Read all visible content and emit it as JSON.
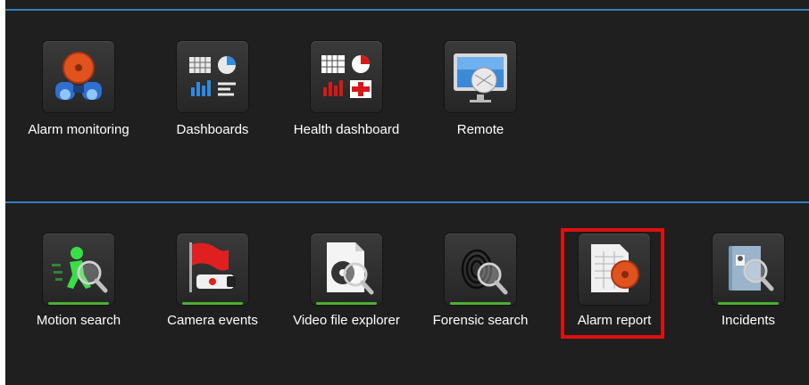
{
  "top_tasks": [
    {
      "label": "Alarm monitoring",
      "icon": "alarm-monitoring-icon"
    },
    {
      "label": "Dashboards",
      "icon": "dashboards-icon"
    },
    {
      "label": "Health dashboard",
      "icon": "health-dashboard-icon"
    },
    {
      "label": "Remote",
      "icon": "remote-icon"
    }
  ],
  "bottom_tasks": [
    {
      "label": "Motion search",
      "icon": "motion-search-icon"
    },
    {
      "label": "Camera events",
      "icon": "camera-events-icon"
    },
    {
      "label": "Video file explorer",
      "icon": "video-file-explorer-icon"
    },
    {
      "label": "Forensic search",
      "icon": "forensic-search-icon"
    },
    {
      "label": "Alarm report",
      "icon": "alarm-report-icon",
      "highlighted": true
    },
    {
      "label": "Incidents",
      "icon": "incidents-icon"
    }
  ],
  "colors": {
    "background": "#1f1f1f",
    "separator": "#2f7fc0",
    "highlight": "#e01010",
    "accent_green": "#4caf32"
  }
}
